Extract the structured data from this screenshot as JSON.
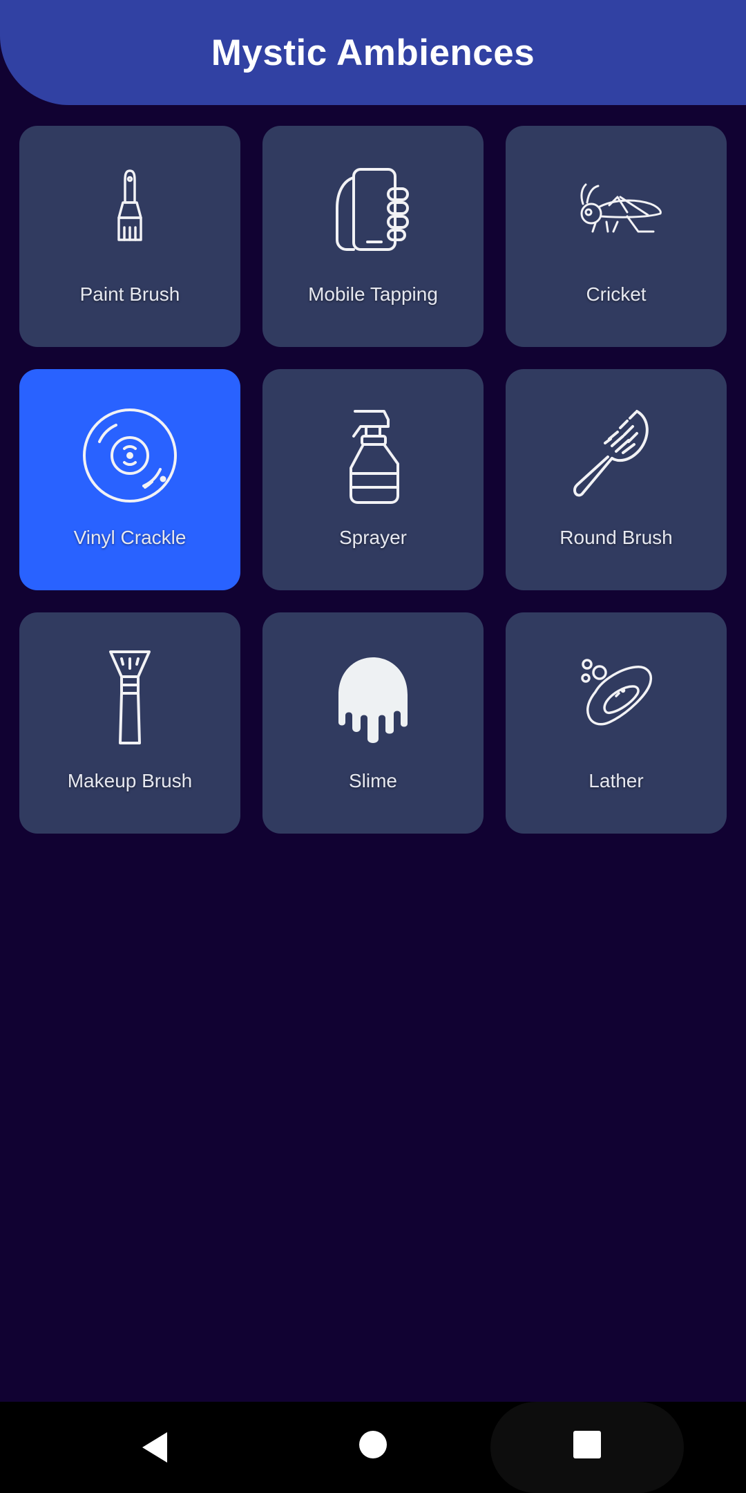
{
  "app": {
    "title": "Mystic Ambiences"
  },
  "tiles": [
    {
      "label": "Paint Brush",
      "icon": "paint-brush-icon"
    },
    {
      "label": "Mobile Tapping",
      "icon": "mobile-tapping-icon"
    },
    {
      "label": "Cricket",
      "icon": "cricket-icon"
    },
    {
      "label": "Vinyl Crackle",
      "icon": "vinyl-record-icon",
      "selected": true
    },
    {
      "label": "Sprayer",
      "icon": "spray-bottle-icon"
    },
    {
      "label": "Round Brush",
      "icon": "round-brush-icon"
    },
    {
      "label": "Makeup Brush",
      "icon": "makeup-brush-icon"
    },
    {
      "label": "Slime",
      "icon": "slime-icon"
    },
    {
      "label": "Lather",
      "icon": "soap-lather-icon"
    }
  ],
  "colors": {
    "background": "#110232",
    "header": "#3141A3",
    "tile": "#313B60",
    "tile_selected": "#2962FF"
  },
  "navbar": {
    "back": "back-icon",
    "home": "home-icon",
    "recents": "recents-icon"
  }
}
